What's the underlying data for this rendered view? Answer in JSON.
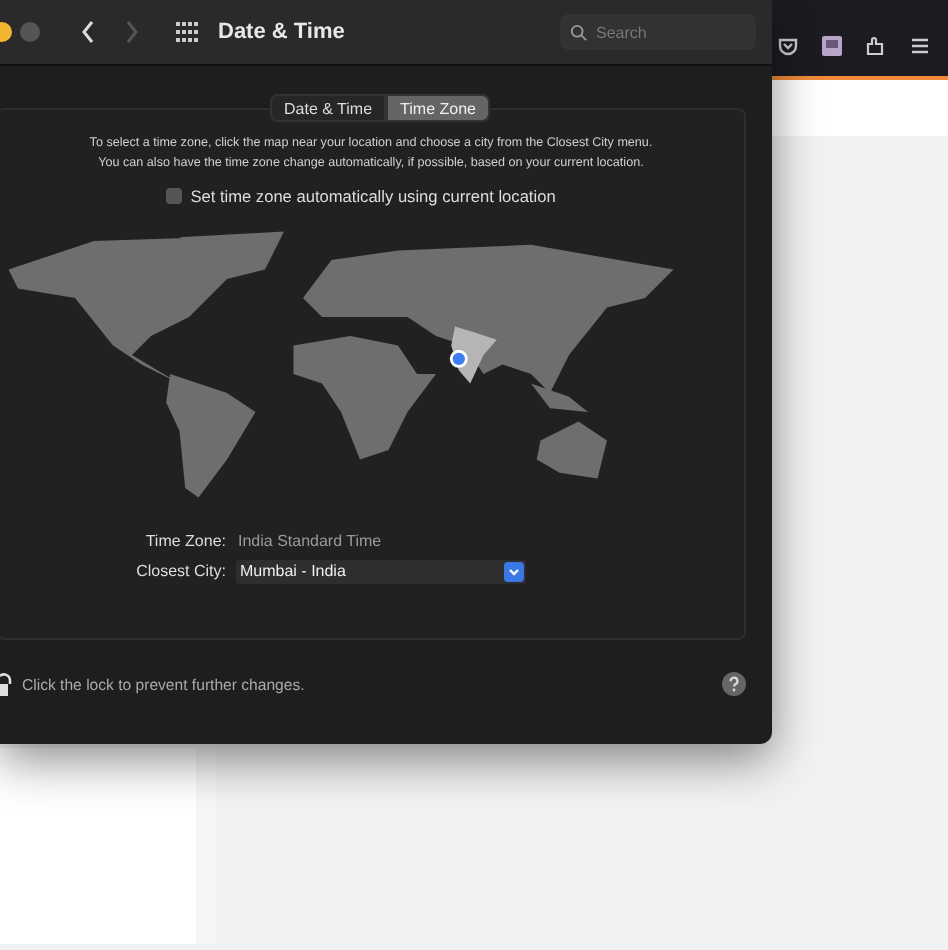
{
  "window": {
    "title": "Date & Time",
    "search": {
      "placeholder": "Search"
    }
  },
  "tabs": [
    {
      "label": "Date & Time",
      "selected": false
    },
    {
      "label": "Time Zone",
      "selected": true
    }
  ],
  "instructions": [
    "To select a time zone, click the map near your location and choose a city from the Closest City menu.",
    "You can also have the time zone change automatically, if possible, based on your current location."
  ],
  "auto_checkbox": {
    "label": "Set time zone automatically using current location",
    "checked": false
  },
  "time_zone": {
    "label": "Time Zone:",
    "value": "India Standard Time"
  },
  "closest_city": {
    "label": "Closest City:",
    "value": "Mumbai - India"
  },
  "lock_text": "Click the lock to prevent further changes."
}
